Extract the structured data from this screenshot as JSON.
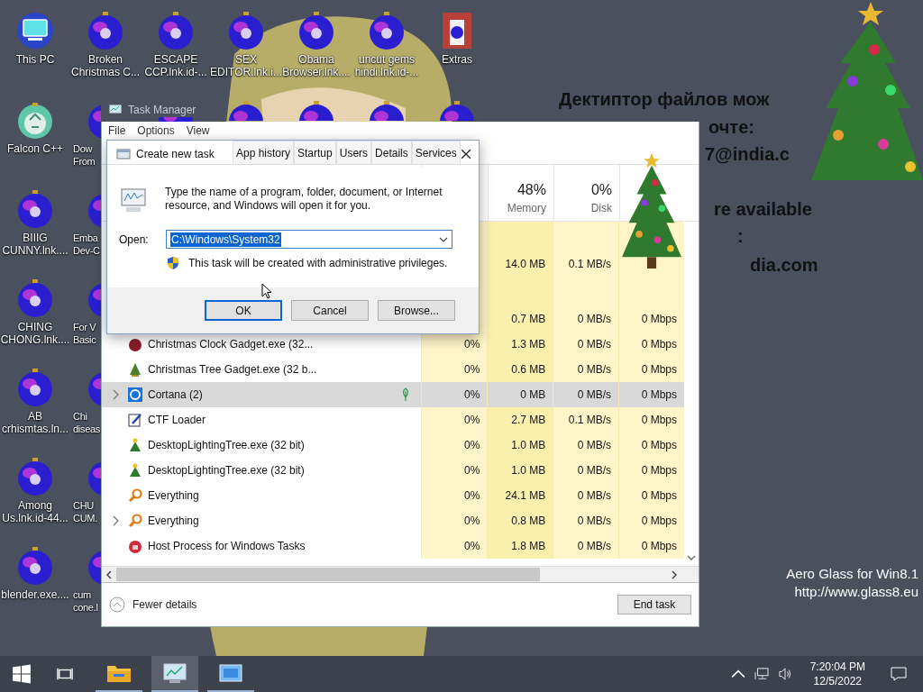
{
  "desktop": {
    "columns": [
      [
        {
          "kind": "computer",
          "covered": false,
          "lines": [
            "This PC"
          ]
        },
        {
          "kind": "recycle",
          "covered": false,
          "lines": [
            "Falcon C++"
          ]
        },
        {
          "kind": "ornament",
          "covered": false,
          "lines": [
            "BIIIG",
            "CUNNY.lnk...."
          ]
        },
        {
          "kind": "ornament",
          "covered": false,
          "lines": [
            "CHING",
            "CHONG.lnk...."
          ]
        },
        {
          "kind": "ornament",
          "covered": false,
          "lines": [
            "AB",
            "crhismtas.ln..."
          ]
        },
        {
          "kind": "ornament",
          "covered": false,
          "lines": [
            "Among",
            "Us.lnk.id-44..."
          ]
        },
        {
          "kind": "ornament",
          "covered": false,
          "lines": [
            "blender.exe...."
          ]
        }
      ],
      [
        {
          "kind": "ornament",
          "covered": false,
          "lines": [
            "Broken",
            "Christmas C..."
          ]
        },
        {
          "kind": "ornament",
          "covered": true,
          "lines": [
            "Dow",
            "From"
          ]
        },
        {
          "kind": "ornament",
          "covered": true,
          "lines": [
            "Emba",
            "Dev-C"
          ]
        },
        {
          "kind": "ornament",
          "covered": true,
          "lines": [
            "For V",
            "Basic"
          ]
        },
        {
          "kind": "ornament",
          "covered": true,
          "lines": [
            "Chi",
            "diseas"
          ]
        },
        {
          "kind": "ornament",
          "covered": true,
          "lines": [
            "CHU",
            "CUM."
          ]
        },
        {
          "kind": "ornament",
          "covered": true,
          "lines": [
            "cum",
            "cone.l"
          ]
        }
      ],
      [
        {
          "kind": "ornament",
          "covered": false,
          "lines": [
            "ESCAPE",
            "CCP.lnk.id-..."
          ]
        },
        {
          "kind": "ornament",
          "covered": true
        }
      ],
      [
        {
          "kind": "ornament",
          "covered": false,
          "lines": [
            "SEX",
            "EDITOR.lnk.i..."
          ]
        },
        {
          "kind": "ornament",
          "covered": true
        }
      ],
      [
        {
          "kind": "ornament",
          "covered": false,
          "lines": [
            "Obama",
            "Browser.lnk...."
          ]
        },
        {
          "kind": "ornament",
          "covered": true
        }
      ],
      [
        {
          "kind": "ornament",
          "covered": false,
          "lines": [
            "uncut gems",
            "hindi.lnk.id-..."
          ]
        },
        {
          "kind": "ornament",
          "covered": true
        }
      ],
      [
        {
          "kind": "art",
          "covered": false,
          "lines": [
            "Extras"
          ]
        },
        {
          "kind": "ornament",
          "covered": true
        }
      ]
    ]
  },
  "wallpaper_text": [
    "Дектиптор файлов мож",
    "очте:",
    "7@india.c",
    "re available",
    ":",
    "dia.com"
  ],
  "task_manager": {
    "title": "Task Manager",
    "menu": [
      "File",
      "Options",
      "View"
    ],
    "tabs": [
      {
        "label": "App history",
        "selected": false
      },
      {
        "label": "Startup",
        "selected": false
      },
      {
        "label": "Users",
        "selected": false
      },
      {
        "label": "Details",
        "selected": false
      },
      {
        "label": "Services",
        "selected": false
      }
    ],
    "headers": {
      "memory": {
        "usage": "48%",
        "label": "Memory"
      },
      "disk": {
        "usage": "0%",
        "label": "Disk"
      }
    },
    "rows": [
      {
        "kind": "group"
      },
      {
        "kind": "process",
        "selected": false,
        "memory": "14.0 MB",
        "disk": "0.1 MB/s"
      },
      {
        "kind": "group"
      },
      {
        "kind": "process",
        "selected": false,
        "memory": "0.7 MB",
        "disk": "0 MB/s",
        "network": "0 Mbps"
      },
      {
        "kind": "process",
        "expandable": false,
        "selected": false,
        "efficiency_mode": false,
        "name": "Christmas Clock Gadget.exe (32...",
        "cpu": "0%",
        "memory": "1.3 MB",
        "disk": "0 MB/s",
        "network": "0 Mbps"
      },
      {
        "kind": "process",
        "expandable": false,
        "selected": false,
        "efficiency_mode": false,
        "name": "Christmas Tree Gadget.exe (32 b...",
        "cpu": "0%",
        "memory": "0.6 MB",
        "disk": "0 MB/s",
        "network": "0 Mbps"
      },
      {
        "kind": "process",
        "expandable": true,
        "selected": true,
        "efficiency_mode": true,
        "name": "Cortana (2)",
        "cpu": "0%",
        "memory": "0 MB",
        "disk": "0 MB/s",
        "network": "0 Mbps"
      },
      {
        "kind": "process",
        "expandable": false,
        "selected": false,
        "efficiency_mode": false,
        "name": "CTF Loader",
        "cpu": "0%",
        "memory": "2.7 MB",
        "disk": "0.1 MB/s",
        "network": "0 Mbps"
      },
      {
        "kind": "process",
        "expandable": false,
        "selected": false,
        "efficiency_mode": false,
        "name": "DesktopLightingTree.exe (32 bit)",
        "cpu": "0%",
        "memory": "1.0 MB",
        "disk": "0 MB/s",
        "network": "0 Mbps"
      },
      {
        "kind": "process",
        "expandable": false,
        "selected": false,
        "efficiency_mode": false,
        "name": "DesktopLightingTree.exe (32 bit)",
        "cpu": "0%",
        "memory": "1.0 MB",
        "disk": "0 MB/s",
        "network": "0 Mbps"
      },
      {
        "kind": "process",
        "expandable": false,
        "selected": false,
        "efficiency_mode": false,
        "name": "Everything",
        "cpu": "0%",
        "memory": "24.1 MB",
        "disk": "0 MB/s",
        "network": "0 Mbps"
      },
      {
        "kind": "process",
        "expandable": true,
        "selected": false,
        "efficiency_mode": false,
        "name": "Everything",
        "cpu": "0%",
        "memory": "0.8 MB",
        "disk": "0 MB/s",
        "network": "0 Mbps"
      },
      {
        "kind": "process",
        "expandable": false,
        "selected": false,
        "efficiency_mode": false,
        "name": "Host Process for Windows Tasks",
        "cpu": "0%",
        "memory": "1.8 MB",
        "disk": "0 MB/s",
        "network": "0 Mbps"
      }
    ],
    "fewer_details": "Fewer details",
    "end_task": "End task"
  },
  "dialog": {
    "title": "Create new task",
    "message": "Type the name of a program, folder, document, or Internet resource, and Windows will open it for you.",
    "open_label": "Open:",
    "value": "C:\\Windows\\System32",
    "value_selected": true,
    "admin_note": "This task will be created with administrative privileges.",
    "buttons": [
      {
        "label": "OK",
        "default": true
      },
      {
        "label": "Cancel",
        "default": false
      },
      {
        "label": "Browse...",
        "default": false
      }
    ]
  },
  "watermark": [
    "Aero Glass for Win8.1",
    "http://www.glass8.eu"
  ],
  "taskbar": {
    "apps": [
      {
        "running": true,
        "selected": false
      },
      {
        "running": true,
        "selected": true
      },
      {
        "running": true,
        "selected": false
      }
    ],
    "time": "7:20:04 PM",
    "date": "12/5/2022"
  }
}
